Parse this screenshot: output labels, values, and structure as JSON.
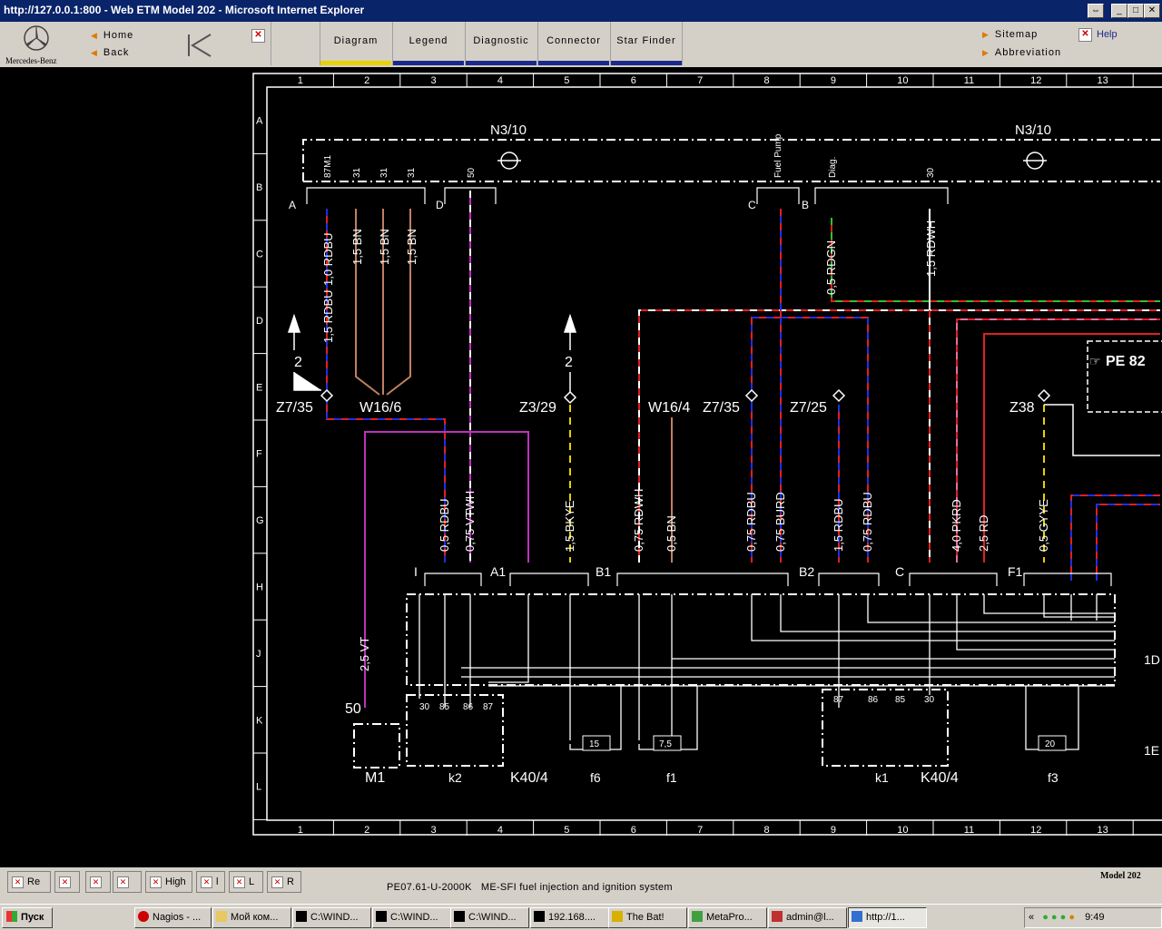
{
  "window": {
    "title": "http://127.0.0.1:800 - Web ETM Model 202 - Microsoft Internet Explorer"
  },
  "nav": {
    "brand": "Mercedes-Benz",
    "home_label": "Home",
    "back_label": "Back",
    "tabs": [
      {
        "label": "Diagram"
      },
      {
        "label": "Legend"
      },
      {
        "label": "Diagnostic"
      },
      {
        "label": "Connector"
      },
      {
        "label": "Star Finder"
      }
    ],
    "sitemap_label": "Sitemap",
    "abbreviation_label": "Abbreviation",
    "help_label": "Help"
  },
  "diagram": {
    "columns": [
      "1",
      "2",
      "3",
      "4",
      "5",
      "6",
      "7",
      "8",
      "9",
      "10",
      "11",
      "12",
      "13"
    ],
    "rows": [
      "A",
      "B",
      "C",
      "D",
      "E",
      "F",
      "G",
      "H",
      "J",
      "K",
      "L"
    ],
    "components": {
      "n310_left": "N3/10",
      "n310_right": "N3/10",
      "w166": "W16/6",
      "w164": "W16/4",
      "z735_left": "Z7/35",
      "z735_mid": "Z7/35",
      "z329": "Z3/29",
      "z725": "Z7/25",
      "z38": "Z38",
      "m1": "M1",
      "k2": "k2",
      "k404_left": "K40/4",
      "k404_right": "K40/4",
      "f6": "f6",
      "f1": "f1",
      "k1": "k1",
      "f3": "f3",
      "pe": "PE 82"
    },
    "connectors": {
      "A": "A",
      "D": "D",
      "C": "C",
      "B": "B",
      "I": "I",
      "A1": "A1",
      "B1": "B1",
      "B2": "B2",
      "C2": "C",
      "F1": "F1"
    },
    "top_pins": [
      "87M1",
      "31",
      "31",
      "31",
      "50",
      "Fuel Pump",
      "Diag.",
      "30"
    ],
    "wire_top": [
      "1,0 RDBU",
      "1,5 RDBU",
      "1,5 BN",
      "1,5 BN",
      "1,5 BN",
      "0,5 RDGN",
      "1,5 RDWH"
    ],
    "wire_bottom": [
      "0,5 RDBU",
      "0,75 VTWH",
      "1,5 BKYE",
      "0,75 RDWH",
      "0,5 BN",
      "0,75 RDBU",
      "0,75 BURD",
      "1,5 RDBU",
      "0,75 RDBU",
      "4,0 PKRD",
      "2,5 RD",
      "0,5 GYYE",
      "2,5 VT"
    ],
    "fuses": [
      "15",
      "7,5",
      "20"
    ],
    "arrow_labels": [
      "2",
      "2"
    ],
    "relay_pins": [
      "30",
      "85",
      "86",
      "87",
      "87",
      "86",
      "85",
      "30",
      "50"
    ],
    "ref_labels": [
      "1D",
      "1E"
    ]
  },
  "status": {
    "buttons": [
      "Re",
      "",
      "",
      "",
      "High",
      "l",
      "L",
      "R"
    ],
    "doc_code": "PE07.61-U-2000K",
    "doc_title": "ME-SFI fuel injection and ignition system",
    "model": "Model 202"
  },
  "taskbar": {
    "start": "Пуск",
    "items": [
      "Nagios - ...",
      "Мой ком...",
      "C:\\WIND...",
      "C:\\WIND...",
      "C:\\WIND...",
      "192.168....",
      "The Bat!",
      "MetaPro...",
      "admin@l...",
      "http://1..."
    ],
    "clock": "9:49"
  },
  "colors": {
    "titlebar": "#0a246a",
    "tab_active": "#e8d200",
    "tab_inactive": "#1b2a8a",
    "wire_red": "#e02020",
    "wire_blue": "#2030e0",
    "wire_violet": "#c030c0",
    "wire_brown": "#c08060"
  }
}
